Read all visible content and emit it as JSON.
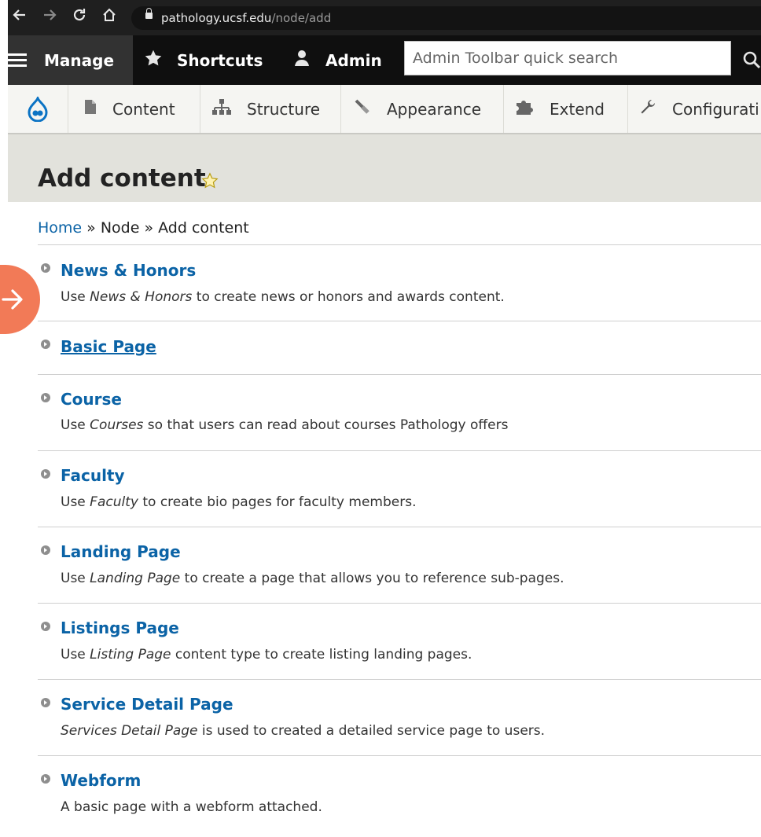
{
  "browser": {
    "url_host": "pathology.ucsf.edu",
    "url_path": "/node/add"
  },
  "toolbar": {
    "manage": "Manage",
    "shortcuts": "Shortcuts",
    "admin": "Admin",
    "search_placeholder": "Admin Toolbar quick search"
  },
  "tray": {
    "items": [
      "Content",
      "Structure",
      "Appearance",
      "Extend",
      "Configurati"
    ]
  },
  "page": {
    "title": "Add content"
  },
  "breadcrumb": {
    "home": "Home",
    "sep1": " » ",
    "node": "Node",
    "sep2": " » ",
    "current": "Add content"
  },
  "content_types": [
    {
      "label": "News & Honors",
      "desc_pre": "Use ",
      "desc_em": "News & Honors",
      "desc_post": " to create news or honors and awards content."
    },
    {
      "label": "Basic Page",
      "desc_pre": "",
      "desc_em": "",
      "desc_post": ""
    },
    {
      "label": "Course",
      "desc_pre": "Use ",
      "desc_em": "Courses",
      "desc_post": " so that users can read about courses Pathology offers"
    },
    {
      "label": "Faculty",
      "desc_pre": "Use ",
      "desc_em": "Faculty",
      "desc_post": " to create bio pages for faculty members."
    },
    {
      "label": "Landing Page",
      "desc_pre": "Use ",
      "desc_em": "Landing Page",
      "desc_post": " to create a page that allows you to reference sub-pages."
    },
    {
      "label": "Listings Page",
      "desc_pre": "Use ",
      "desc_em": "Listing Page",
      "desc_post": " content type to create listing landing pages."
    },
    {
      "label": "Service Detail Page",
      "desc_pre": "",
      "desc_em": "Services Detail Page",
      "desc_post": " is used to created a detailed service page to users."
    },
    {
      "label": "Webform",
      "desc_pre": "A basic page with a webform attached.",
      "desc_em": "",
      "desc_post": ""
    }
  ],
  "colors": {
    "link": "#0b63a6",
    "toolbar_bg": "#0f0f0f",
    "manage_bg": "#323232",
    "header_bg": "#e2e2dc",
    "badge": "#f27a57",
    "star": "#f2c200"
  },
  "icons": [
    "back-arrow-icon",
    "forward-arrow-icon",
    "reload-icon",
    "home-icon",
    "lock-icon",
    "hamburger-icon",
    "star-icon",
    "user-icon",
    "search-icon",
    "drupal-logo-icon",
    "document-icon",
    "sitemap-icon",
    "paintbrush-icon",
    "puzzle-icon",
    "wrench-icon",
    "arrow-right-icon"
  ]
}
